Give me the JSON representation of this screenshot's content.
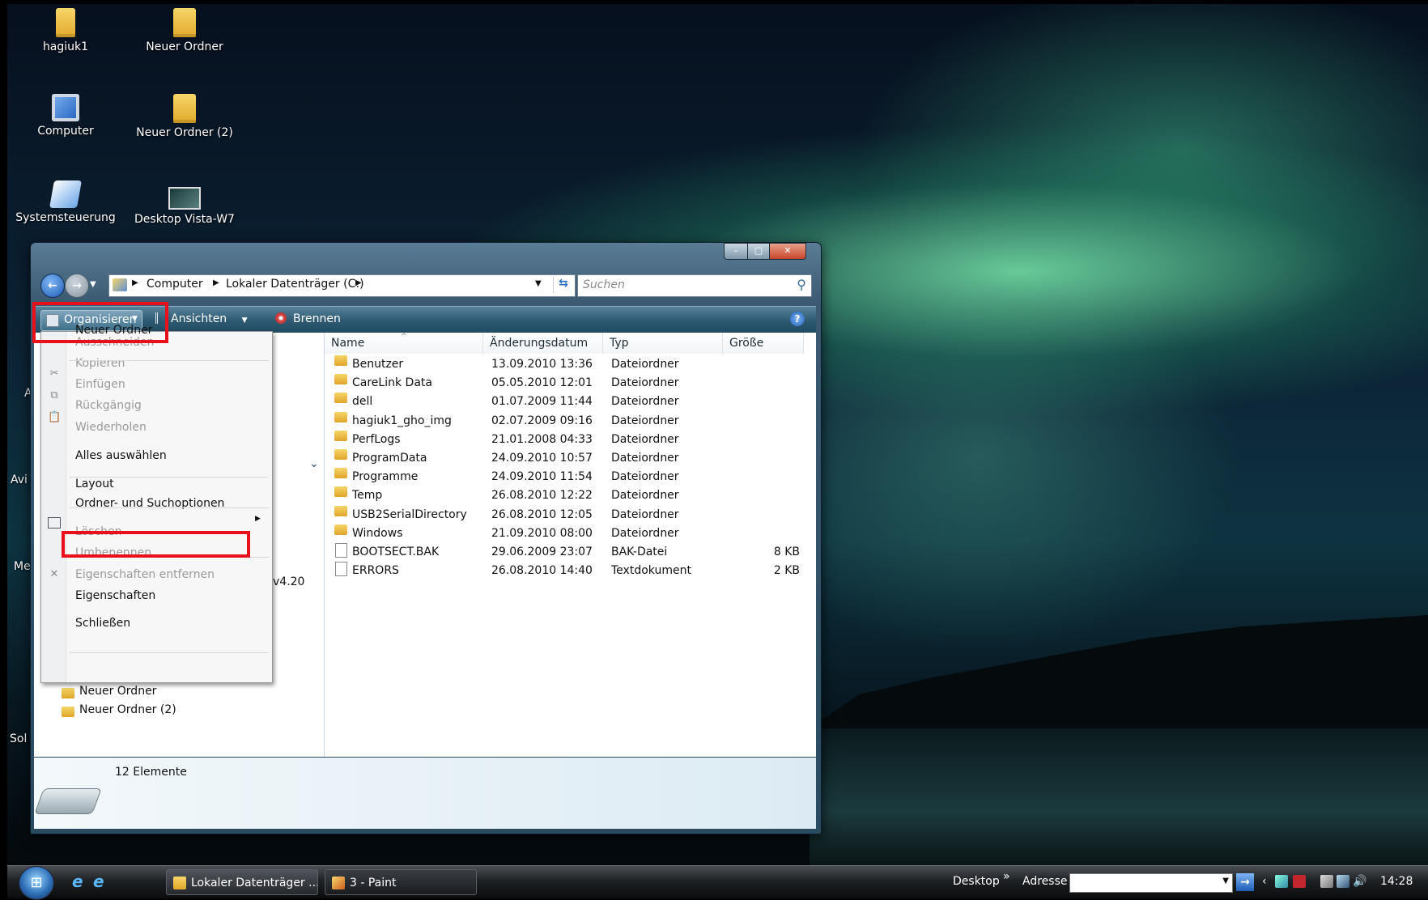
{
  "desktop": {
    "icons": [
      {
        "id": "hagiuk1",
        "label": "hagiuk1"
      },
      {
        "id": "neuer-ordner",
        "label": "Neuer Ordner"
      },
      {
        "id": "computer",
        "label": "Computer"
      },
      {
        "id": "neuer-ordner-2",
        "label": "Neuer Ordner (2)"
      },
      {
        "id": "systemsteuerung",
        "label": "Systemsteuerung"
      },
      {
        "id": "desktop-vista",
        "label": "Desktop Vista-W7"
      }
    ],
    "partial_labels": [
      "A",
      "Avi",
      "Me",
      "Sol"
    ]
  },
  "explorer": {
    "window_buttons": {
      "minimize": "–",
      "maximize": "□",
      "close": "✕"
    },
    "breadcrumb": [
      "Computer",
      "Lokaler Datenträger (C:)"
    ],
    "search_placeholder": "Suchen",
    "toolbar": {
      "organize": "Organisieren",
      "views": "Ansichten",
      "burn": "Brennen",
      "help": "?"
    },
    "columns": [
      "Name",
      "Änderungsdatum",
      "Typ",
      "Größe"
    ],
    "files": [
      {
        "name": "Benutzer",
        "date": "13.09.2010 13:36",
        "type": "Dateiordner",
        "size": "",
        "kind": "folder"
      },
      {
        "name": "CareLink Data",
        "date": "05.05.2010 12:01",
        "type": "Dateiordner",
        "size": "",
        "kind": "folder"
      },
      {
        "name": "dell",
        "date": "01.07.2009 11:44",
        "type": "Dateiordner",
        "size": "",
        "kind": "folder"
      },
      {
        "name": "hagiuk1_gho_img",
        "date": "02.07.2009 09:16",
        "type": "Dateiordner",
        "size": "",
        "kind": "folder"
      },
      {
        "name": "PerfLogs",
        "date": "21.01.2008 04:33",
        "type": "Dateiordner",
        "size": "",
        "kind": "folder"
      },
      {
        "name": "ProgramData",
        "date": "24.09.2010 10:57",
        "type": "Dateiordner",
        "size": "",
        "kind": "folder"
      },
      {
        "name": "Programme",
        "date": "24.09.2010 11:54",
        "type": "Dateiordner",
        "size": "",
        "kind": "folder"
      },
      {
        "name": "Temp",
        "date": "26.08.2010 12:22",
        "type": "Dateiordner",
        "size": "",
        "kind": "folder"
      },
      {
        "name": "USB2SerialDirectory",
        "date": "26.08.2010 12:05",
        "type": "Dateiordner",
        "size": "",
        "kind": "folder"
      },
      {
        "name": "Windows",
        "date": "21.09.2010 08:00",
        "type": "Dateiordner",
        "size": "",
        "kind": "folder"
      },
      {
        "name": "BOOTSECT.BAK",
        "date": "29.06.2009 23:07",
        "type": "BAK-Datei",
        "size": "8 KB",
        "kind": "file"
      },
      {
        "name": "ERRORS",
        "date": "26.08.2010 14:40",
        "type": "Textdokument",
        "size": "2 KB",
        "kind": "file"
      }
    ],
    "nav_pane": {
      "partial_text": "v4.20",
      "tree_items": [
        "Neuer Ordner",
        "Neuer Ordner (2)"
      ]
    },
    "status": "12 Elemente"
  },
  "menu": {
    "items": [
      {
        "label": "Neuer Ordner",
        "enabled": true
      },
      {
        "label": "Ausschneiden",
        "enabled": false
      },
      {
        "label": "Kopieren",
        "enabled": false
      },
      {
        "label": "Einfügen",
        "enabled": false
      },
      {
        "label": "Rückgängig",
        "enabled": false
      },
      {
        "label": "Wiederholen",
        "enabled": false
      },
      {
        "label": "Alles auswählen",
        "enabled": true
      },
      {
        "label": "Layout",
        "enabled": true
      },
      {
        "label": "Ordner- und Suchoptionen",
        "enabled": true
      },
      {
        "label": "Löschen",
        "enabled": false
      },
      {
        "label": "Umbenennen",
        "enabled": false
      },
      {
        "label": "Eigenschaften entfernen",
        "enabled": false
      },
      {
        "label": "Eigenschaften",
        "enabled": true
      },
      {
        "label": "Schließen",
        "enabled": true
      }
    ]
  },
  "taskbar": {
    "apps": [
      "Lokaler Datenträger ...",
      "3 - Paint"
    ],
    "desktop_label": "Desktop",
    "chevron": "»",
    "address_label": "Adresse",
    "clock": "14:28"
  },
  "colors": {
    "highlight": "#e8101a",
    "toolbar": "#2d5a72"
  }
}
